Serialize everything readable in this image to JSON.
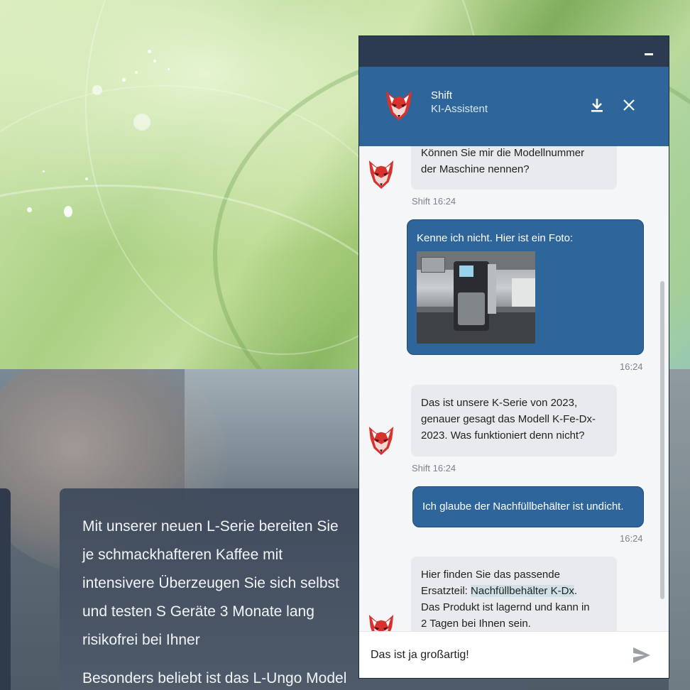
{
  "website": {
    "paragraph1": "Mit unserer neuen L-Serie bereiten Sie je schmackhafteren Kaffee mit intensivere Überzeugen Sie sich selbst und testen S Geräte 3 Monate lang risikofrei bei Ihner",
    "paragraph2": "Besonders beliebt ist das L-Ungo Model Verbrauch und vollem Genuss."
  },
  "chat": {
    "header": {
      "name": "Shift",
      "role": "KI-Assistent",
      "download_icon": "download-icon",
      "close_icon": "close-icon",
      "minimize_icon": "minimize-icon"
    },
    "messages": [
      {
        "from": "bot",
        "text_lines": [
          "Können Sie mir die Modellnummer",
          "der Maschine nennen?"
        ],
        "meta": "Shift 16:24"
      },
      {
        "from": "user",
        "text": "Kenne ich nicht. Hier ist ein Foto:",
        "attachment": "photo-coffee-machine",
        "meta": "16:24"
      },
      {
        "from": "bot",
        "text_lines": [
          "Das ist unsere K-Serie von 2023,",
          "genauer gesagt das Modell K-Fe-Dx-",
          "2023. Was funktioniert denn nicht?"
        ],
        "meta": "Shift 16:24"
      },
      {
        "from": "user",
        "text": "Ich glaube der Nachfüllbehälter ist undicht.",
        "meta": "16:24"
      },
      {
        "from": "bot",
        "text_pre": "Hier finden Sie das passende",
        "text_prefix": "Ersatzteil: ",
        "link": "Nachfüllbehälter K-Dx",
        "text_suffix": ".",
        "text_lines": [
          "Das Produkt ist lagernd und kann in",
          "2 Tagen bei Ihnen sein."
        ]
      }
    ],
    "input": {
      "value": "Das ist ja großartig!",
      "send_icon": "send-icon"
    }
  },
  "colors": {
    "header": "#2e669c",
    "topbar": "#2c3a52",
    "user_bubble": "#2e669c",
    "bot_bubble": "#e8eaed"
  }
}
